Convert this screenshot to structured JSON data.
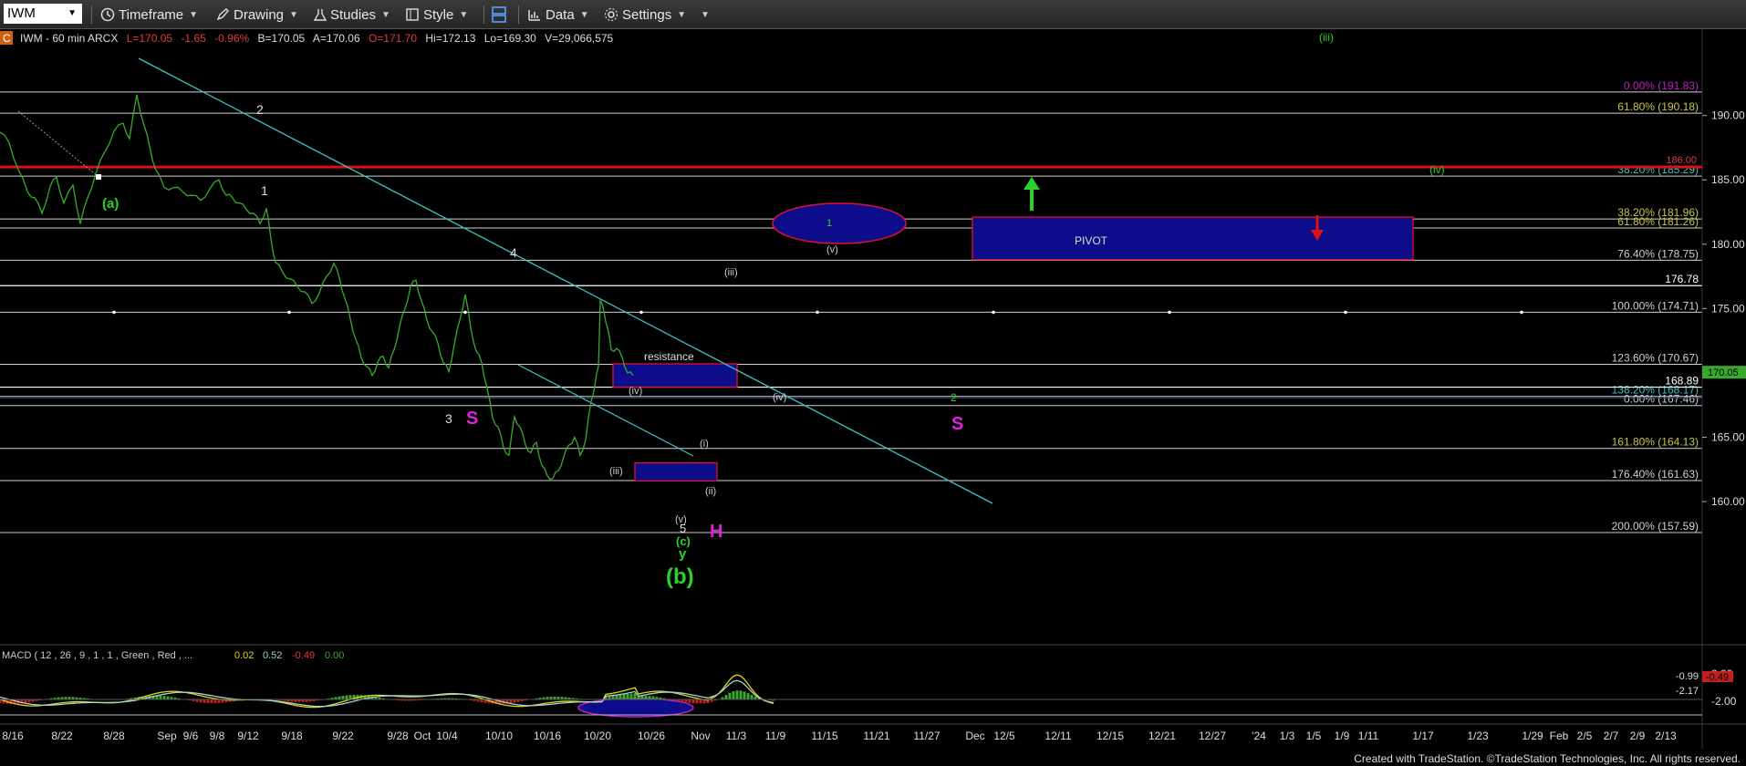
{
  "toolbar": {
    "symbol": "IWM",
    "items": [
      "Timeframe",
      "Drawing",
      "Studies",
      "Style",
      "Data",
      "Settings"
    ]
  },
  "header": {
    "corner": "C",
    "symbol_line": "IWM - 60 min  ARCX",
    "last": "L=170.05",
    "change": "-1.65",
    "change_pct": "-0.96%",
    "bid": "B=170.05",
    "ask": "A=170.06",
    "open": "O=171.70",
    "high": "Hi=172.13",
    "low": "Lo=169.30",
    "volume": "V=29,066,575"
  },
  "price_axis": {
    "ticks": [
      "190.00",
      "185.00",
      "180.00",
      "175.00",
      "170.00",
      "165.00",
      "160.00"
    ],
    "last_price_tag": "170.05",
    "resistance_tag": "186.00",
    "level_tag": "168.89",
    "level_tag_2": "176.78"
  },
  "fib_levels": [
    {
      "label": "0.00% (191.83)",
      "value": 191.83
    },
    {
      "label": "61.80% (190.18)",
      "value": 190.18
    },
    {
      "label": "38.20% (185.29)",
      "value": 185.29
    },
    {
      "label": "38.20% (181.96)",
      "value": 181.96
    },
    {
      "label": "61.80% (181.26)",
      "value": 181.26
    },
    {
      "label": "76.40% (178.75)",
      "value": 178.75
    },
    {
      "label": "100.00% (174.71)",
      "value": 174.71
    },
    {
      "label": "123.60% (170.67)",
      "value": 170.67
    },
    {
      "label": "138.20% (168.17)",
      "value": 168.17
    },
    {
      "label": "0.00% (167.46)",
      "value": 167.46
    },
    {
      "label": "161.80% (164.13)",
      "value": 164.13
    },
    {
      "label": "176.40% (161.63)",
      "value": 161.63
    },
    {
      "label": "200.00% (157.59)",
      "value": 157.59
    }
  ],
  "chart_data": {
    "type": "line",
    "title": "IWM - 60 min",
    "x": [
      "8/16",
      "8/22",
      "8/28",
      "Sep",
      "9/6",
      "9/8",
      "9/12",
      "9/18",
      "9/22",
      "9/28",
      "Oct",
      "10/4",
      "10/10",
      "10/16",
      "10/20",
      "10/26",
      "Nov",
      "11/3",
      "11/9",
      "11/15",
      "11/21",
      "11/27",
      "Dec",
      "12/5",
      "12/11",
      "12/15",
      "12/21",
      "12/27",
      "'24",
      "1/3",
      "1/5",
      "1/9",
      "1/11",
      "1/17",
      "1/23",
      "1/29",
      "Feb",
      "2/5",
      "2/7",
      "2/9",
      "2/13"
    ],
    "price_series": [
      [
        0,
        188.7
      ],
      [
        10,
        187.9
      ],
      [
        20,
        185.8
      ],
      [
        30,
        184.1
      ],
      [
        38,
        183.6
      ],
      [
        46,
        182.4
      ],
      [
        55,
        184.5
      ],
      [
        62,
        185.2
      ],
      [
        70,
        183.2
      ],
      [
        80,
        184.6
      ],
      [
        88,
        181.6
      ],
      [
        96,
        183.6
      ],
      [
        105,
        185.5
      ],
      [
        115,
        187.2
      ],
      [
        125,
        188.8
      ],
      [
        135,
        189.4
      ],
      [
        142,
        188.2
      ],
      [
        150,
        191.6
      ],
      [
        158,
        189.2
      ],
      [
        164,
        187.6
      ],
      [
        170,
        185.9
      ],
      [
        180,
        184.4
      ],
      [
        190,
        184.4
      ],
      [
        200,
        184.1
      ],
      [
        210,
        183.8
      ],
      [
        220,
        183.4
      ],
      [
        230,
        184.3
      ],
      [
        240,
        185.0
      ],
      [
        248,
        183.8
      ],
      [
        255,
        183.6
      ],
      [
        262,
        183.2
      ],
      [
        270,
        182.7
      ],
      [
        278,
        182.4
      ],
      [
        285,
        181.6
      ],
      [
        292,
        182.8
      ],
      [
        297,
        180.4
      ],
      [
        302,
        178.6
      ],
      [
        310,
        177.8
      ],
      [
        318,
        177.3
      ],
      [
        326,
        176.7
      ],
      [
        334,
        176.3
      ],
      [
        342,
        175.4
      ],
      [
        350,
        176.2
      ],
      [
        358,
        177.5
      ],
      [
        366,
        178.5
      ],
      [
        372,
        177.4
      ],
      [
        378,
        175.8
      ],
      [
        384,
        174.2
      ],
      [
        390,
        172.6
      ],
      [
        396,
        171.2
      ],
      [
        402,
        170.5
      ],
      [
        408,
        169.8
      ],
      [
        414,
        170.8
      ],
      [
        420,
        171.3
      ],
      [
        426,
        170.4
      ],
      [
        432,
        171.8
      ],
      [
        438,
        173.6
      ],
      [
        444,
        175.0
      ],
      [
        450,
        176.7
      ],
      [
        456,
        177.2
      ],
      [
        462,
        175.6
      ],
      [
        468,
        174.1
      ],
      [
        474,
        173.2
      ],
      [
        480,
        172.3
      ],
      [
        486,
        170.8
      ],
      [
        492,
        170.1
      ],
      [
        498,
        172.2
      ],
      [
        504,
        174.1
      ],
      [
        510,
        176.1
      ],
      [
        516,
        173.5
      ],
      [
        522,
        171.7
      ],
      [
        528,
        170.8
      ],
      [
        534,
        168.8
      ],
      [
        540,
        166.5
      ],
      [
        546,
        165.8
      ],
      [
        552,
        164.2
      ],
      [
        558,
        163.6
      ],
      [
        564,
        166.6
      ],
      [
        570,
        165.8
      ],
      [
        576,
        164.4
      ],
      [
        582,
        163.8
      ],
      [
        588,
        164.6
      ],
      [
        594,
        162.8
      ],
      [
        600,
        162.0
      ],
      [
        606,
        161.8
      ],
      [
        612,
        162.4
      ],
      [
        618,
        163.5
      ],
      [
        624,
        164.4
      ],
      [
        630,
        165.0
      ],
      [
        636,
        163.6
      ],
      [
        642,
        164.8
      ],
      [
        648,
        167.8
      ],
      [
        652,
        169.0
      ],
      [
        656,
        170.5
      ],
      [
        658,
        175.6
      ],
      [
        662,
        174.8
      ],
      [
        666,
        173.5
      ],
      [
        670,
        171.8
      ],
      [
        676,
        171.9
      ],
      [
        682,
        171.2
      ],
      [
        688,
        170.0
      ],
      [
        694,
        169.8
      ]
    ],
    "ylim": [
      156.5,
      192.5
    ],
    "macd": {
      "label": "MACD ( 12 , 26 , 9 , 1 , 1 , Green , Red , ...",
      "values": [
        "0.02",
        "0.52",
        "-0.49",
        "0.00"
      ],
      "axis_ticks": [
        "2.00",
        "-2.00"
      ],
      "tag_macd": "-0.99",
      "tag_hist": "-0.49",
      "level_label": "-2.17"
    },
    "zones": [
      {
        "name": "pivot",
        "label": "PIVOT",
        "top": 182.1,
        "bottom": 178.8
      },
      {
        "name": "resistance",
        "label": "resistance",
        "top": 170.7,
        "bottom": 168.9
      },
      {
        "name": "support",
        "label": "",
        "top": 163.0,
        "bottom": 161.6
      }
    ],
    "wave_labels": [
      "(a)",
      "(b)",
      "(c)",
      "y",
      "5",
      "(v)",
      "(iv)",
      "(iii)",
      "(ii)",
      "(i)",
      "1",
      "2",
      "3",
      "4",
      "S",
      "S",
      "H",
      "(iii)",
      "(iv)",
      "(v)",
      "1",
      "2",
      "(iii)",
      "(iv)"
    ],
    "credit": "Created with TradeStation. ©TradeStation Technologies, Inc. All rights reserved."
  },
  "colors": {
    "price": "#3aaa2e",
    "trendline": "#3ec3c3",
    "resistance": "#e01010",
    "zone": "#0d0d8c",
    "zone_border": "#e01030",
    "magenta": "#e020e0",
    "green_label": "#2bd12b"
  }
}
